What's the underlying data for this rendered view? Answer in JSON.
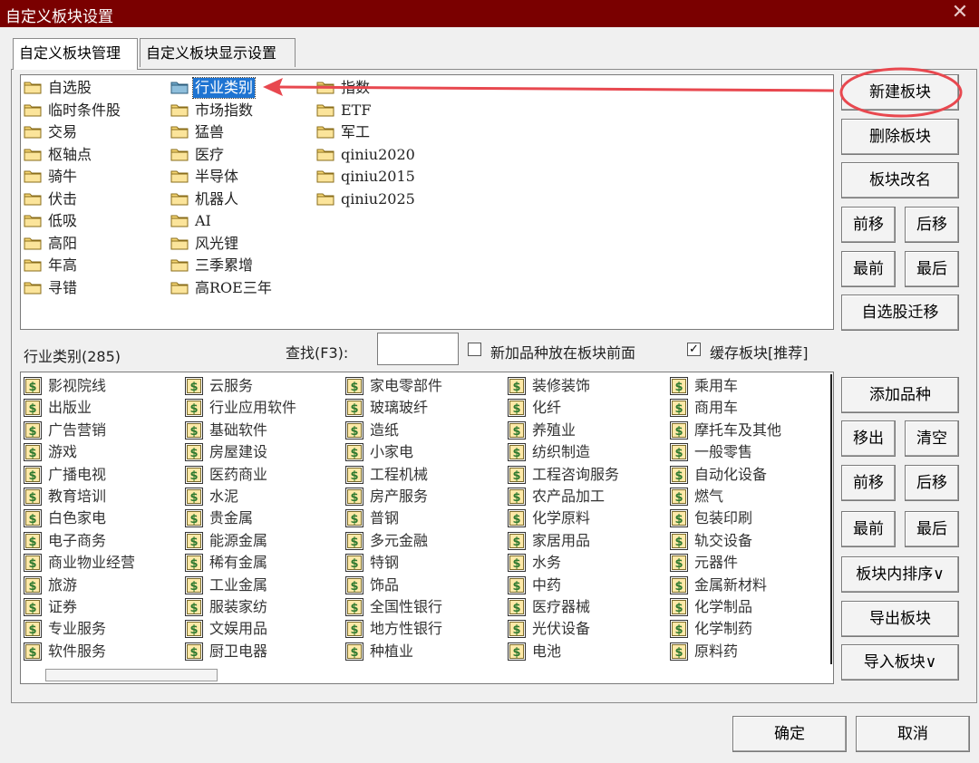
{
  "window": {
    "title": "自定义板块设置",
    "close_glyph": "✕"
  },
  "tabs": [
    {
      "label": "自定义板块管理"
    },
    {
      "label": "自定义板块显示设置"
    }
  ],
  "blocks": {
    "col1": [
      "自选股",
      "临时条件股",
      "交易",
      "枢轴点",
      "骑牛",
      "伏击",
      "低吸",
      "高阳",
      "年高",
      "寻错"
    ],
    "col2": [
      "行业类别",
      "市场指数",
      "猛兽",
      "医疗",
      "半导体",
      "机器人",
      "AI",
      "风光锂",
      "三季累增",
      "高ROE三年"
    ],
    "col3": [
      "指数",
      "ETF",
      "军工",
      "qiniu2020",
      "qiniu2015",
      "qiniu2025"
    ],
    "selected": "行业类别"
  },
  "block_buttons": {
    "new": "新建板块",
    "delete": "删除板块",
    "rename": "板块改名",
    "move_up": "前移",
    "move_down": "后移",
    "first": "最前",
    "last": "最后",
    "migrate": "自选股迁移"
  },
  "middle": {
    "category_label": "行业类别(285)",
    "search_label": "查找(F3):",
    "search_value": "",
    "option_new_front": {
      "label": "新加品种放在板块前面",
      "checked": false
    },
    "option_cache": {
      "label": "缓存板块[推荐]",
      "checked": true,
      "mark": "✓"
    }
  },
  "stocks": {
    "col1": [
      "影视院线",
      "出版业",
      "广告营销",
      "游戏",
      "广播电视",
      "教育培训",
      "白色家电",
      "电子商务",
      "商业物业经营",
      "旅游",
      "证券",
      "专业服务",
      "软件服务"
    ],
    "col2": [
      "云服务",
      "行业应用软件",
      "基础软件",
      "房屋建设",
      "医药商业",
      "水泥",
      "贵金属",
      "能源金属",
      "稀有金属",
      "工业金属",
      "服装家纺",
      "文娱用品",
      "厨卫电器"
    ],
    "col3": [
      "家电零部件",
      "玻璃玻纤",
      "造纸",
      "小家电",
      "工程机械",
      "房产服务",
      "普钢",
      "多元金融",
      "特钢",
      "饰品",
      "全国性银行",
      "地方性银行",
      "种植业"
    ],
    "col4": [
      "装修装饰",
      "化纤",
      "养殖业",
      "纺织制造",
      "工程咨询服务",
      "农产品加工",
      "化学原料",
      "家居用品",
      "水务",
      "中药",
      "医疗器械",
      "光伏设备",
      "电池"
    ],
    "col5": [
      "乘用车",
      "商用车",
      "摩托车及其他",
      "一般零售",
      "自动化设备",
      "燃气",
      "包装印刷",
      "轨交设备",
      "元器件",
      "金属新材料",
      "化学制品",
      "化学制药",
      "原料药"
    ]
  },
  "stock_buttons": {
    "add": "添加品种",
    "remove": "移出",
    "clear": "清空",
    "move_up": "前移",
    "move_down": "后移",
    "first": "最前",
    "last": "最后",
    "sort": "板块内排序∨",
    "export": "导出板块",
    "import": "导入板块∨"
  },
  "footer": {
    "ok": "确定",
    "cancel": "取消"
  },
  "colors": {
    "titlebar": "#7a0000",
    "selection": "#1e74d2",
    "annotation": "#e8484f"
  }
}
